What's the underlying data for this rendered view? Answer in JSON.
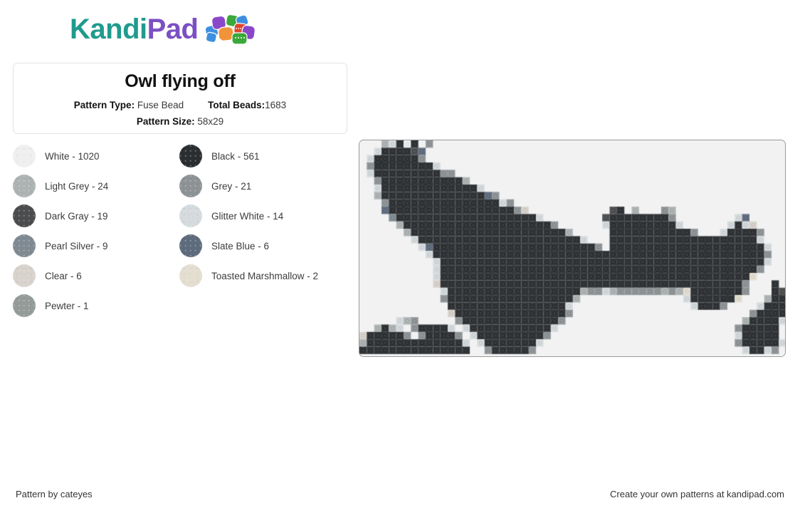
{
  "logo": {
    "text_primary": "Kandi",
    "text_secondary": "Pad",
    "primary_color": "#1f9b8e",
    "secondary_color": "#7b4fc4",
    "icon_name": "kandi-beads-cluster-icon"
  },
  "card": {
    "title": "Owl flying off",
    "pattern_type_label": "Pattern Type:",
    "pattern_type_value": "Fuse Bead",
    "total_beads_label": "Total Beads:",
    "total_beads_value": "1683",
    "pattern_size_label": "Pattern Size:",
    "pattern_size_value": "58x29"
  },
  "legend": [
    {
      "name": "White - 1020",
      "color": "#efefef"
    },
    {
      "name": "Black - 561",
      "color": "#2b2e31"
    },
    {
      "name": "Light Grey - 24",
      "color": "#adb3b2"
    },
    {
      "name": "Grey - 21",
      "color": "#8d9295"
    },
    {
      "name": "Dark Gray - 19",
      "color": "#4a4c4e"
    },
    {
      "name": "Glitter White - 14",
      "color": "#d4dadd"
    },
    {
      "name": "Pearl Silver - 9",
      "color": "#7f8a92"
    },
    {
      "name": "Slate Blue - 6",
      "color": "#5d6b7d"
    },
    {
      "name": "Clear - 6",
      "color": "#d8d2cc"
    },
    {
      "name": "Toasted Marshmallow - 2",
      "color": "#e3ded0"
    },
    {
      "name": "Pewter - 1",
      "color": "#939c99"
    }
  ],
  "pattern": {
    "canvas_name": "bead-pattern-canvas",
    "cols": 58,
    "rows": 29,
    "cell": 10.34,
    "background": "#f2f2f2",
    "palette": {
      "0": "#f2f2f2",
      "W": "#efefef",
      "K": "#2b2e31",
      "L": "#adb3b2",
      "G": "#8d9295",
      "D": "#4a4c4e",
      "T": "#d4dadd",
      "P": "#7f8a92",
      "S": "#5d6b7d",
      "C": "#d8d2cc",
      "M": "#e3ded0",
      "E": "#939c99"
    },
    "rows_data": [
      "0.0LTKWK0G...........................................000000",
      "0.TKKKKDS0..........................................000000",
      "0TKKKKKKG0.........................................0000000",
      ".GKKKKKKKKT0.......................................0000000",
      "0TKKKKKKKKKGG0.....................................0000000",
      "0.GKKKKKKKKKKKL0...................................000000.",
      "0.TKKKKKKKKKKKKKT0.................................00000..",
      "..LKKKKKKKKKKKKKKSG0...............................0000...",
      "...GKKKKKKKKKKKKKKKTG0.............................000....",
      "...SKKKKKKKKKKKKKKKKKGC0..........DK.L...GL........000....",
      "....PKKKKKKKKKKKKKKKKKKKT0.......DKKKKKKKKG.......0TS.....",
      ".....LKKKKKKKKKKKKKKKKKKKKG0.....TKKKKKKKKKT0....0TKTC....",
      "......LKKKKKKKKKKKKKKKKKKKKKL0...0KKKKKKKKKKKG..0TKKKKG...",
      ".......TKKKKKKKKKKKKKKKKKKKKKKT0.0KKKKKKKKKKKKKKKKKKKKT...",
      "........TSKKKKKKKKKKKKKKKKKKKKKKG0KKKKKKKKKKKKKKKKKKKKKT..",
      ".........TKKKKKKKKKKKKKKKKKKKKKKKKKKKKKKKKKKKKKKKKKKKKKG..",
      "..........TKKKKKKKKKKKKKKKKKKKKKKKKKKKKKKKKKKKKKKKKKKKKT..",
      "..........TKKKKKKKKKKKKKKKKKKKKKKKKKKKKKKKKKKKKKKKKKKKG...",
      "..........TKKKKKKKKKKKKKKKKKKKKKKKKKKKKKKKKKKKKKKKKKKM0...",
      "..........CKKKKKKKKKKKKKKKKKKKKKKKKKKKKKKKKKKKKKKKKKG0..K.",
      "...........TKKKKKKKKKKKKKKKKKKLGGTLGGGGGGLGLMKKKKKKKG0..KD",
      "...........GKKKKKKKKKKKKKKKKKL0....0.......0TKKKKKKM0..LKK",
      "...........0KKKKKKKKKKKKKKKKT0..............0TKKKG0...TKKK",
      "............CKKKKKKKKKKKKKKKG0................00.0...GKKKK",
      ".....TLG0....GKKKKKKKKKKKKKG0.......................LKKKKT",
      "..LKLT0GKKKKT0TKKKKKKKKKKKT0.......................GKKKKK0",
      "CKKKKKG0GKKKKG0TKKKKKKKKKG0........................TKKKKK0",
      "LKKKKKKKKKKKKKT0TKKKKKKKT0.........................GKKKKKT",
      "KKKKKKKKKKKKKKK00GKKKKKG0..........................0TKKTG0"
    ]
  },
  "footer": {
    "left": "Pattern by cateyes",
    "right": "Create your own patterns at kandipad.com"
  }
}
